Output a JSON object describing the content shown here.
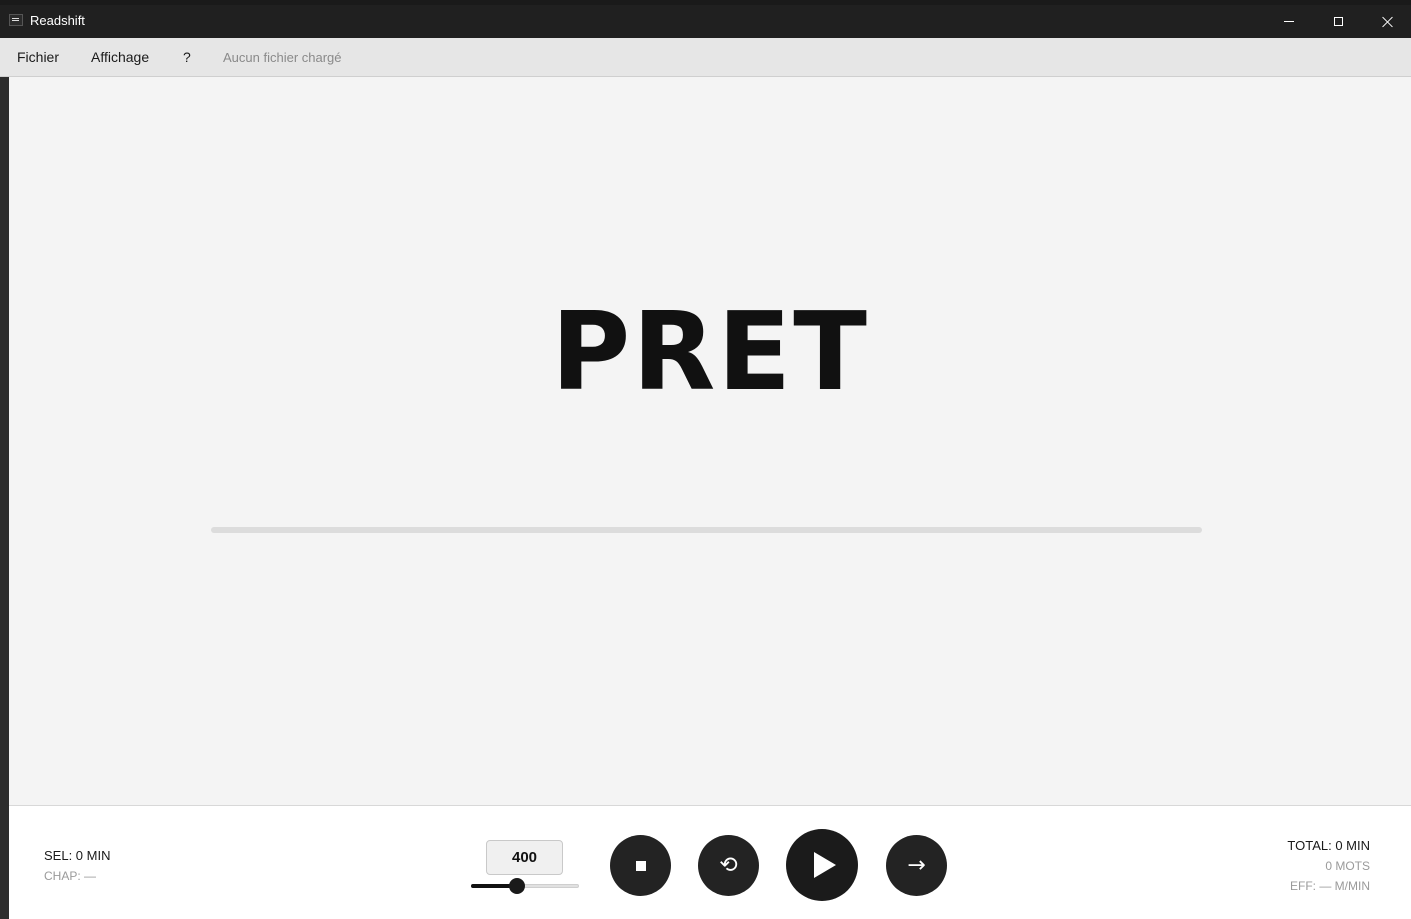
{
  "window": {
    "title": "Readshift",
    "icon": "app-icon",
    "controls": [
      "minimize-icon",
      "maximize-icon",
      "close-icon"
    ]
  },
  "menu": {
    "items": [
      {
        "label": "Fichier"
      },
      {
        "label": "Affichage"
      },
      {
        "label": "?"
      }
    ],
    "status": "Aucun fichier chargé"
  },
  "reader": {
    "word": "PRET",
    "progress": 0
  },
  "controls": {
    "sel": "SEL: 0 MIN",
    "chap": "CHAP: —",
    "speed": "400",
    "slider_level": 0.43,
    "buttons": {
      "stop_icon": "stop-icon",
      "restart_icon": "restart-icon",
      "restart_glyph": "⟲",
      "play_icon": "play-icon",
      "next_icon": "arrow-right-icon",
      "next_glyph": "→"
    },
    "total": "TOTAL: 0 MIN",
    "words": "0 MOTS",
    "eff": "EFF: — M/MIN"
  },
  "colors": {
    "titlebar": "#202020",
    "menubar": "#e6e6e6",
    "reader_bg": "#f4f4f4",
    "button_bg": "#232323",
    "text": "#111111"
  }
}
